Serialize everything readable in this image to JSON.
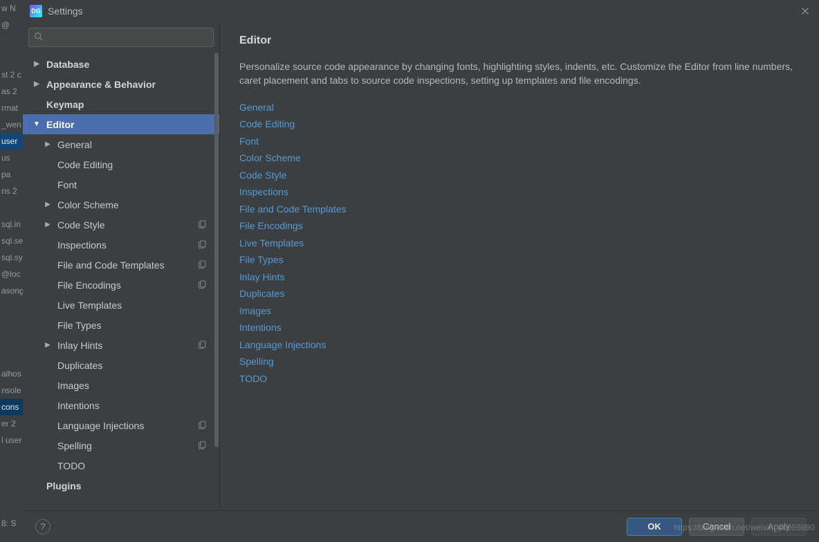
{
  "window": {
    "title": "Settings",
    "app_icon_text": "DG"
  },
  "search": {
    "placeholder": ""
  },
  "sidebar": {
    "items": [
      {
        "label": "Database",
        "kind": "top",
        "arrow": "right"
      },
      {
        "label": "Appearance & Behavior",
        "kind": "top",
        "arrow": "right"
      },
      {
        "label": "Keymap",
        "kind": "top",
        "arrow": "none"
      },
      {
        "label": "Editor",
        "kind": "top",
        "arrow": "down",
        "selected": true
      },
      {
        "label": "General",
        "kind": "child",
        "arrow": "right"
      },
      {
        "label": "Code Editing",
        "kind": "child",
        "arrow": "none"
      },
      {
        "label": "Font",
        "kind": "child",
        "arrow": "none"
      },
      {
        "label": "Color Scheme",
        "kind": "child",
        "arrow": "right"
      },
      {
        "label": "Code Style",
        "kind": "child",
        "arrow": "right",
        "copy": true
      },
      {
        "label": "Inspections",
        "kind": "child",
        "arrow": "none",
        "copy": true
      },
      {
        "label": "File and Code Templates",
        "kind": "child",
        "arrow": "none",
        "copy": true
      },
      {
        "label": "File Encodings",
        "kind": "child",
        "arrow": "none",
        "copy": true
      },
      {
        "label": "Live Templates",
        "kind": "child",
        "arrow": "none"
      },
      {
        "label": "File Types",
        "kind": "child",
        "arrow": "none"
      },
      {
        "label": "Inlay Hints",
        "kind": "child",
        "arrow": "right",
        "copy": true
      },
      {
        "label": "Duplicates",
        "kind": "child",
        "arrow": "none"
      },
      {
        "label": "Images",
        "kind": "child",
        "arrow": "none"
      },
      {
        "label": "Intentions",
        "kind": "child",
        "arrow": "none"
      },
      {
        "label": "Language Injections",
        "kind": "child",
        "arrow": "none",
        "copy": true
      },
      {
        "label": "Spelling",
        "kind": "child",
        "arrow": "none",
        "copy": true
      },
      {
        "label": "TODO",
        "kind": "child",
        "arrow": "none"
      },
      {
        "label": "Plugins",
        "kind": "top",
        "arrow": "none"
      }
    ]
  },
  "content": {
    "heading": "Editor",
    "description": "Personalize source code appearance by changing fonts, highlighting styles, indents, etc. Customize the Editor from line numbers, caret placement and tabs to source code inspections, setting up templates and file encodings.",
    "links": [
      "General",
      "Code Editing",
      "Font",
      "Color Scheme",
      "Code Style",
      "Inspections",
      "File and Code Templates",
      "File Encodings",
      "Live Templates",
      "File Types",
      "Inlay Hints",
      "Duplicates",
      "Images",
      "Intentions",
      "Language Injections",
      "Spelling",
      "TODO"
    ]
  },
  "buttons": {
    "ok": "OK",
    "cancel": "Cancel",
    "apply": "Apply",
    "help": "?"
  },
  "background": {
    "rows": [
      "w  N",
      " @",
      "",
      "",
      "st  2 c",
      "as 2",
      "rmat",
      "_wen",
      "user",
      "  us",
      "  pa",
      "ns 2",
      "",
      "sql.in",
      "sql.se",
      "sql.sy",
      "@loc",
      "asong",
      "",
      "",
      "",
      "",
      "alhos",
      "nsole",
      "cons",
      "er  2",
      "l user",
      "",
      "",
      "",
      "",
      "8: S"
    ],
    "selected_indices": [
      8,
      24
    ]
  },
  "watermark": "https://blog.csdn.net/weixin_40959890"
}
